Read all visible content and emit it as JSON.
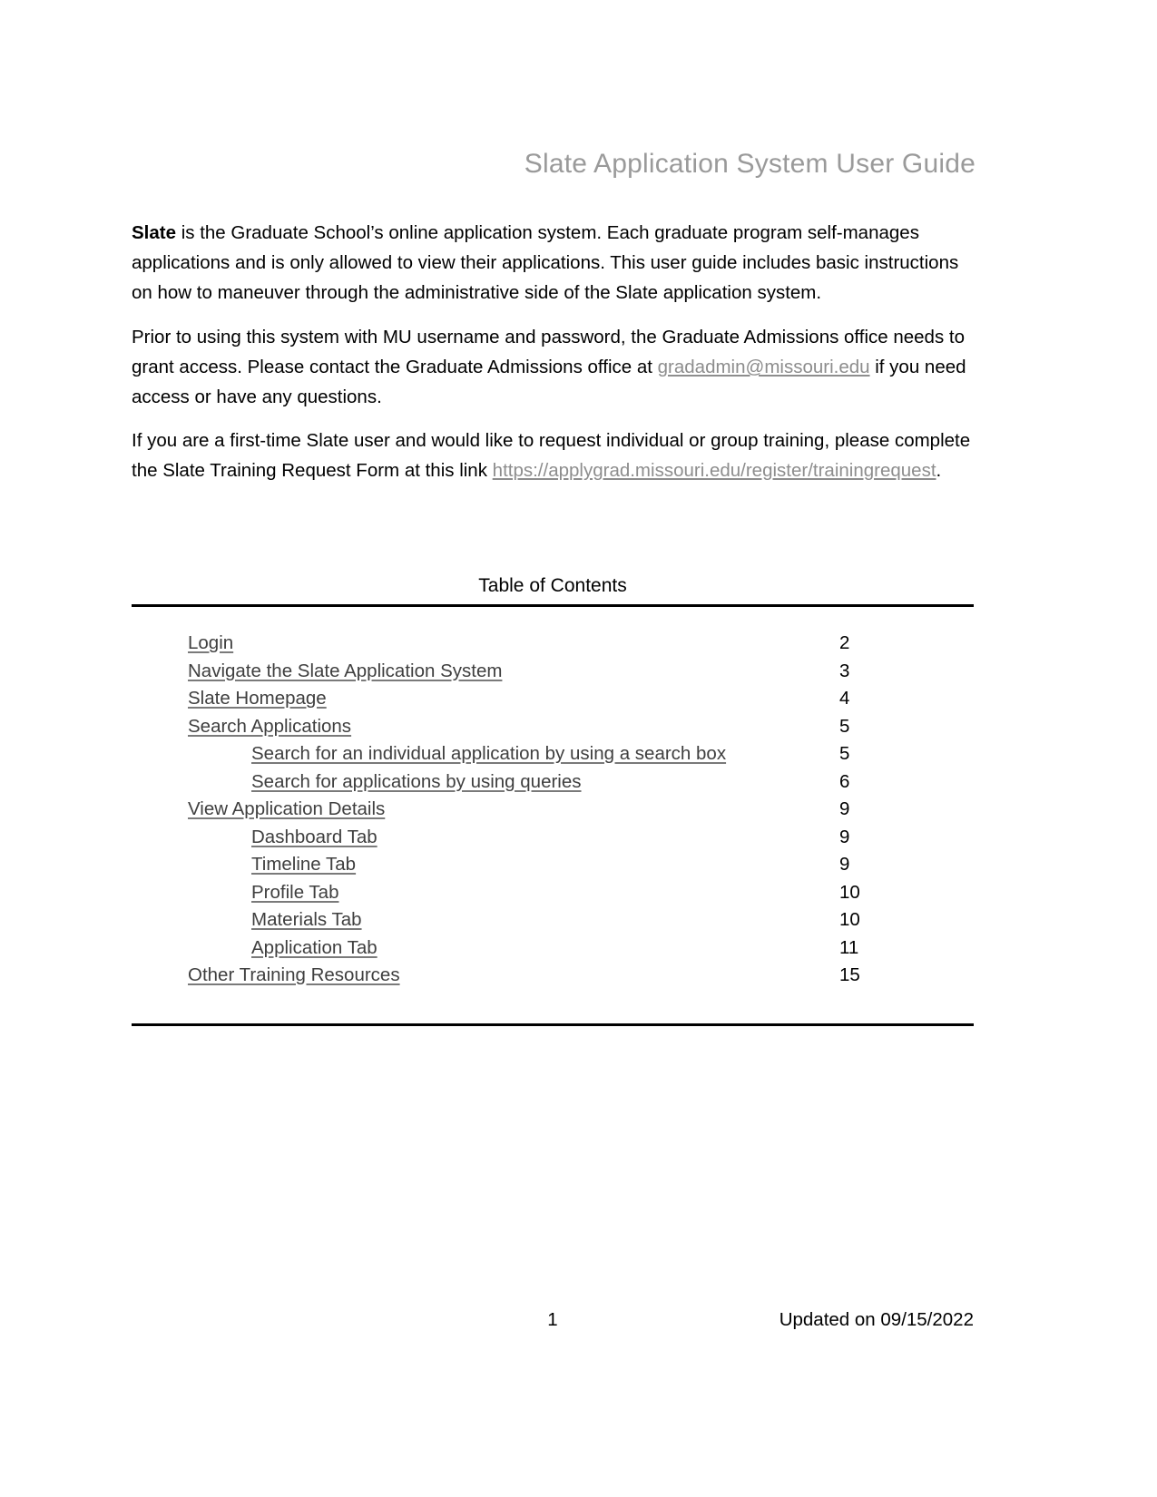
{
  "document": {
    "title": "Slate Application System User Guide"
  },
  "paragraphs": {
    "intro": {
      "bold_lead": "Slate",
      "rest": " is the Graduate School’s online application system. Each graduate program self-manages applications and is only allowed to view their applications. This user guide includes basic instructions on how to maneuver through the administrative side of the Slate application system."
    },
    "access": {
      "before_link": "Prior to using this system with MU username and password, the Graduate Admissions office needs to grant access. Please contact the Graduate Admissions office at ",
      "email_link": "gradadmin@missouri.edu",
      "after_link": " if you need access or have any questions."
    },
    "training": {
      "before_link": "If you are a first-time Slate user and would like to request individual or group training, please complete the Slate Training Request Form at this link ",
      "url_link": "https://applygrad.missouri.edu/register/trainingrequest",
      "after_link": "."
    }
  },
  "toc": {
    "heading": "Table of Contents",
    "entries": [
      {
        "label": "Login",
        "page": "2",
        "level": 1
      },
      {
        "label": "Navigate the Slate Application System",
        "page": "3",
        "level": 1
      },
      {
        "label": "Slate Homepage",
        "page": "4",
        "level": 1
      },
      {
        "label": "Search Applications",
        "page": "5",
        "level": 1
      },
      {
        "label": "Search for an individual application by using a search box",
        "page": "5",
        "level": 2
      },
      {
        "label": "Search for applications by using queries",
        "page": "6",
        "level": 2
      },
      {
        "label": "View Application Details",
        "page": "9",
        "level": 1
      },
      {
        "label": "Dashboard Tab",
        "page": "9",
        "level": 2
      },
      {
        "label": "Timeline Tab",
        "page": "9",
        "level": 2
      },
      {
        "label": "Profile Tab",
        "page": "10",
        "level": 2
      },
      {
        "label": "Materials Tab",
        "page": "10",
        "level": 2
      },
      {
        "label": "Application Tab",
        "page": "11",
        "level": 2
      },
      {
        "label": "Other Training Resources",
        "page": "15",
        "level": 1
      }
    ]
  },
  "footer": {
    "page_number": "1",
    "updated": "Updated on 09/15/2022"
  },
  "colors": {
    "title_gray": "#9a9a9a",
    "link_gray": "#8d8d8d",
    "toc_link": "#3f3f3f",
    "rule_black": "#000000"
  }
}
